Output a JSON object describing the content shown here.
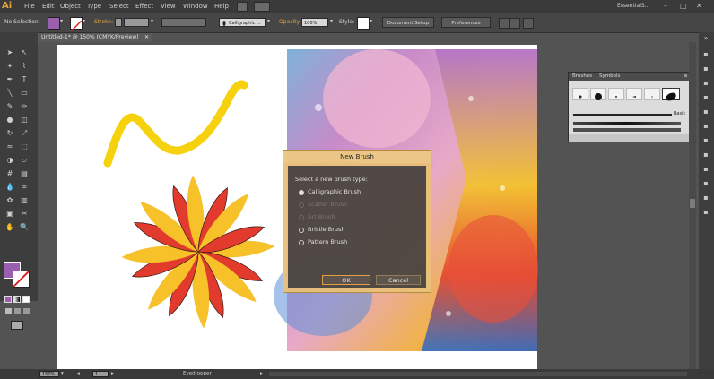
{
  "app": {
    "logo": "Ai",
    "workspace": "EssentialS...",
    "window_buttons": [
      "–",
      "□",
      "✕"
    ]
  },
  "menu": [
    "File",
    "Edit",
    "Object",
    "Type",
    "Select",
    "Effect",
    "View",
    "Window",
    "Help"
  ],
  "controlbar": {
    "selection": "No Selection",
    "stroke_label": "Stroke:",
    "brush_name": "Calligraphic ...",
    "opacity_label": "Opacity:",
    "opacity_value": "100%",
    "style_label": "Style:",
    "document_setup": "Document Setup",
    "preferences": "Preferences",
    "dropdown_arrow": "▾"
  },
  "document": {
    "tab_title": "Untitled-1* @ 150% (CMYK/Preview)",
    "tab_close": "✕"
  },
  "dialog": {
    "title": "New Brush",
    "prompt": "Select a new brush type:",
    "options": [
      {
        "label": "Calligraphic Brush",
        "enabled": true,
        "selected": true
      },
      {
        "label": "Scatter Brush",
        "enabled": false,
        "selected": false
      },
      {
        "label": "Art Brush",
        "enabled": false,
        "selected": false
      },
      {
        "label": "Bristle Brush",
        "enabled": true,
        "selected": false
      },
      {
        "label": "Pattern Brush",
        "enabled": true,
        "selected": false
      }
    ],
    "ok": "OK",
    "cancel": "Cancel"
  },
  "brushes_panel": {
    "tabs": [
      "Brushes",
      "Symbols"
    ],
    "basic_label": "Basic"
  },
  "statusbar": {
    "zoom": "150%",
    "page": "1",
    "tool": "Eyedropper"
  },
  "colors": {
    "fill": "#9b5fb0",
    "stroke": "#ffffff",
    "accent": "#e8a33d",
    "squiggle": "#f6d10e",
    "flower_yellow": "#f7c229",
    "flower_red": "#e23b2e"
  },
  "icons": {
    "tools": [
      "selection-icon",
      "direct-selection-icon",
      "magic-wand-icon",
      "lasso-icon",
      "pen-icon",
      "type-icon",
      "line-icon",
      "rectangle-icon",
      "paintbrush-icon",
      "pencil-icon",
      "blob-brush-icon",
      "eraser-icon",
      "rotate-icon",
      "scale-icon",
      "width-icon",
      "free-transform-icon",
      "shape-builder-icon",
      "perspective-icon",
      "mesh-icon",
      "gradient-icon",
      "eyedropper-icon",
      "blend-icon",
      "symbol-sprayer-icon",
      "graph-icon",
      "artboard-icon",
      "slice-icon",
      "hand-icon",
      "zoom-icon"
    ]
  }
}
